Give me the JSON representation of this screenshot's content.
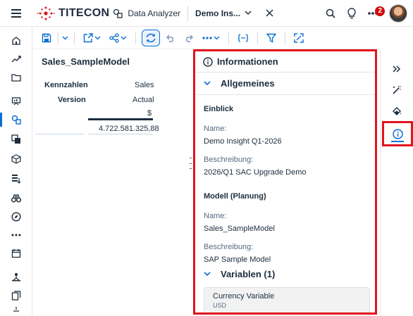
{
  "shell": {
    "brand_name": "TITECON",
    "app_name": "Data Analyzer",
    "document_title": "Demo Ins...",
    "notification_count": "2",
    "brand_color": "#e0141e",
    "accent_color": "#0a6ed1"
  },
  "leftnav": {
    "items": [
      "home-icon",
      "trend-icon",
      "folder-icon",
      "presentation-icon",
      "data-analyzer-icon",
      "datasets-icon",
      "cube-icon",
      "stories-icon",
      "binoculars-icon",
      "compass-icon",
      "more-icon",
      "calendar-icon",
      "hierarchy-icon",
      "files-icon"
    ],
    "active_index": 4
  },
  "sheet": {
    "title": "Sales_SampleModel",
    "row1_label": "Kennzahlen",
    "row1_value": "Sales",
    "row2_label": "Version",
    "row2_value": "Actual",
    "unit": "$",
    "amount": "4.722.581.325,88"
  },
  "panel": {
    "title": "Informationen",
    "general_section": "Allgemeines",
    "insight_group": "Einblick",
    "insight_name_label": "Name:",
    "insight_name": "Demo Insight Q1-2026",
    "insight_desc_label": "Beschreibung:",
    "insight_desc": "2026/Q1 SAC Upgrade Demo",
    "model_group": "Modell (Planung)",
    "model_name_label": "Name:",
    "model_name": "Sales_SampleModel",
    "model_desc_label": "Beschreibung:",
    "model_desc": "SAP Sample Model",
    "variables_section": "Variablen (1)",
    "variable_name": "Currency Variable",
    "variable_value": "USD"
  }
}
